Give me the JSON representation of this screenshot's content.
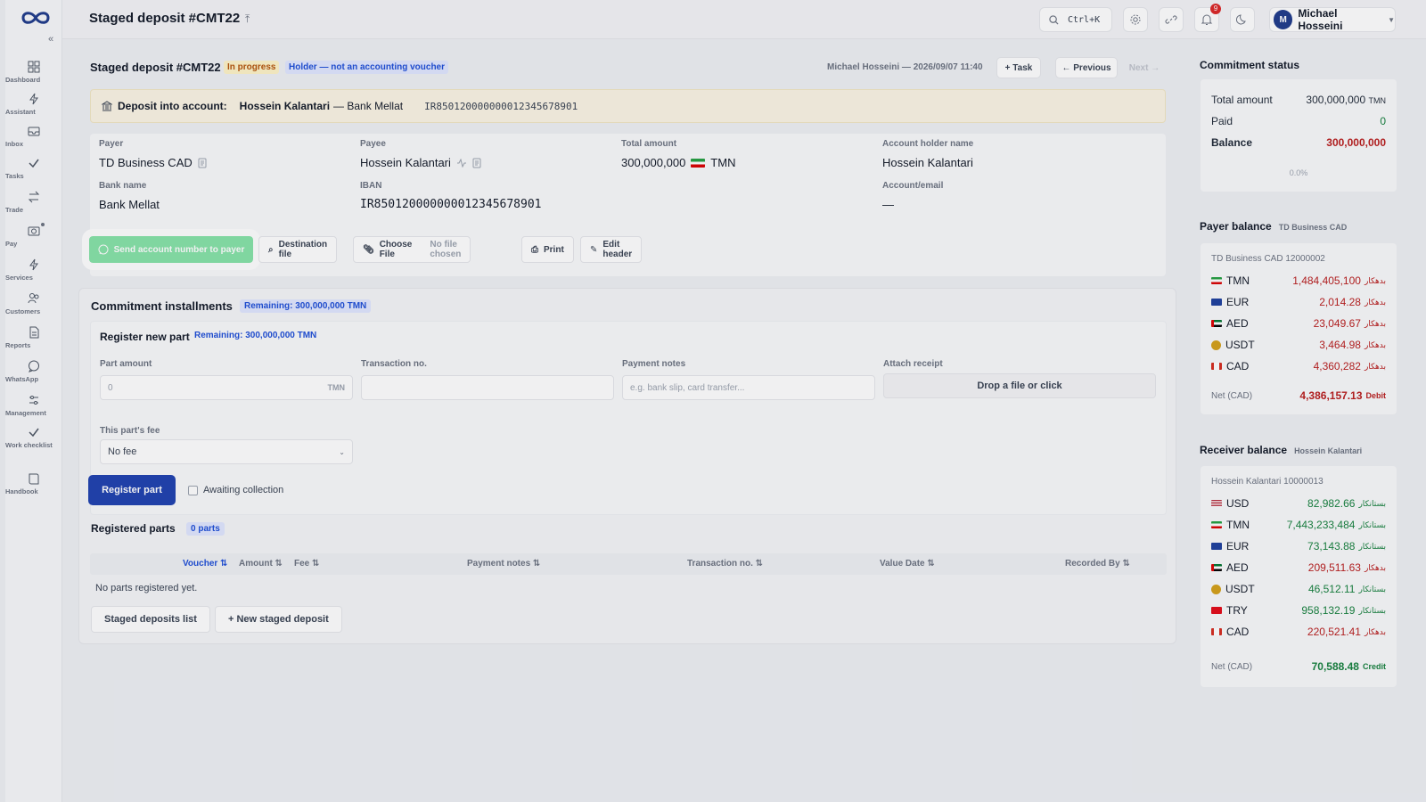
{
  "sidebar": {
    "items": [
      {
        "label": "Dashboard",
        "icon": "dashboard-icon"
      },
      {
        "label": "Assistant",
        "icon": "bolt-icon"
      },
      {
        "label": "Inbox",
        "icon": "inbox-icon"
      },
      {
        "label": "Tasks",
        "icon": "check-icon"
      },
      {
        "label": "Trade",
        "icon": "swap-icon"
      },
      {
        "label": "Pay",
        "icon": "camera-icon"
      },
      {
        "label": "Services",
        "icon": "bolt-icon"
      },
      {
        "label": "Customers",
        "icon": "users-icon"
      },
      {
        "label": "Reports",
        "icon": "file-icon"
      },
      {
        "label": "WhatsApp",
        "icon": "chat-icon"
      },
      {
        "label": "Management",
        "icon": "sliders-icon"
      },
      {
        "label": "Work checklist",
        "icon": "check-icon"
      },
      {
        "label": "Handbook",
        "icon": "book-icon"
      }
    ]
  },
  "topbar": {
    "title": "Staged deposit #CMT22",
    "search_shortcut": "Ctrl+K",
    "notifications_count": "9",
    "user_initial": "M",
    "user_name": "Michael Hosseini"
  },
  "header": {
    "title": "Staged deposit #CMT22",
    "status": "In progress",
    "holder_badge": "Holder — not an accounting voucher",
    "meta": "Michael Hosseini — 2026/09/07 11:40",
    "task_btn": "+ Task",
    "prev_btn": "← Previous",
    "next_btn": "Next →"
  },
  "deposit": {
    "label": "Deposit into account:",
    "account_name": "Hossein Kalantari",
    "bank": "— Bank Mellat",
    "iban": "IR850120000000012345678901"
  },
  "details": {
    "payer_label": "Payer",
    "payer": "TD Business CAD",
    "payee_label": "Payee",
    "payee": "Hossein Kalantari",
    "total_label": "Total amount",
    "total": "300,000,000",
    "total_currency": "TMN",
    "holder_label": "Account holder name",
    "holder": "Hossein Kalantari",
    "bank_label": "Bank name",
    "bank": "Bank Mellat",
    "iban_label": "IBAN",
    "iban": "IR850120000000012345678901",
    "email_label": "Account/email",
    "email": "—"
  },
  "actions": {
    "send": "Send account number to payer",
    "destination": "Destination file",
    "choose": "Choose File",
    "no_file": "No file chosen",
    "print": "Print",
    "edit": "Edit header"
  },
  "installments": {
    "title": "Commitment installments",
    "remaining": "Remaining: 300,000,000 TMN",
    "register_title": "Register new part",
    "register_remaining": "Remaining: 300,000,000 TMN",
    "part_amount_label": "Part amount",
    "part_amount_placeholder": "0",
    "part_amount_unit": "TMN",
    "txn_label": "Transaction no.",
    "notes_label": "Payment notes",
    "notes_placeholder": "e.g. bank slip, card transfer...",
    "receipt_label": "Attach receipt",
    "receipt_drop": "Drop a file or click",
    "fee_label": "This part's fee",
    "fee_value": "No fee",
    "register_btn": "Register part",
    "awaiting": "Awaiting collection",
    "parts_title": "Registered parts",
    "parts_count": "0 parts",
    "columns": [
      "Voucher ⇅",
      "Amount ⇅",
      "Fee ⇅",
      "Payment notes ⇅",
      "Transaction no. ⇅",
      "Value Date ⇅",
      "Recorded By ⇅"
    ],
    "empty": "No parts registered yet.",
    "list_btn": "Staged deposits list",
    "new_btn": "+ New staged deposit"
  },
  "commitment_status": {
    "title": "Commitment status",
    "total_label": "Total amount",
    "total": "300,000,000",
    "total_unit": "TMN",
    "paid_label": "Paid",
    "paid": "0",
    "balance_label": "Balance",
    "balance": "300,000,000",
    "pct": "0.0%"
  },
  "payer_balance": {
    "title": "Payer balance",
    "sub": "TD Business CAD",
    "account": "TD Business CAD 12000002",
    "rows": [
      {
        "cur": "TMN",
        "amt": "1,484,405,100",
        "unit": "بدهکار"
      },
      {
        "cur": "EUR",
        "amt": "2,014.28",
        "unit": "بدهکار"
      },
      {
        "cur": "AED",
        "amt": "23,049.67",
        "unit": "بدهکار"
      },
      {
        "cur": "USDT",
        "amt": "3,464.98",
        "unit": "بدهکار"
      },
      {
        "cur": "CAD",
        "amt": "4,360,282",
        "unit": "بدهکار"
      }
    ],
    "net_label": "Net (CAD)",
    "net": "4,386,157.13",
    "net_type": "Debit"
  },
  "receiver_balance": {
    "title": "Receiver balance",
    "sub": "Hossein Kalantari",
    "account": "Hossein Kalantari 10000013",
    "rows": [
      {
        "cur": "USD",
        "amt": "82,982.66",
        "unit": "بستانکار"
      },
      {
        "cur": "TMN",
        "amt": "7,443,233,484",
        "unit": "بستانکار"
      },
      {
        "cur": "EUR",
        "amt": "73,143.88",
        "unit": "بستانکار"
      },
      {
        "cur": "AED",
        "amt": "209,511.63",
        "unit": "بدهکار"
      },
      {
        "cur": "USDT",
        "amt": "46,512.11",
        "unit": "بستانکار"
      },
      {
        "cur": "TRY",
        "amt": "958,132.19",
        "unit": "بستانکار"
      },
      {
        "cur": "CAD",
        "amt": "220,521.41",
        "unit": "بدهکار"
      }
    ],
    "net_label": "Net (CAD)",
    "net": "70,588.48",
    "net_type": "Credit"
  },
  "colors": {
    "primary": "#1e40af",
    "whatsapp": "#86e3a8",
    "debit": "#b91c1c",
    "credit": "#15803d",
    "warning_bg": "#fbf5e4"
  }
}
